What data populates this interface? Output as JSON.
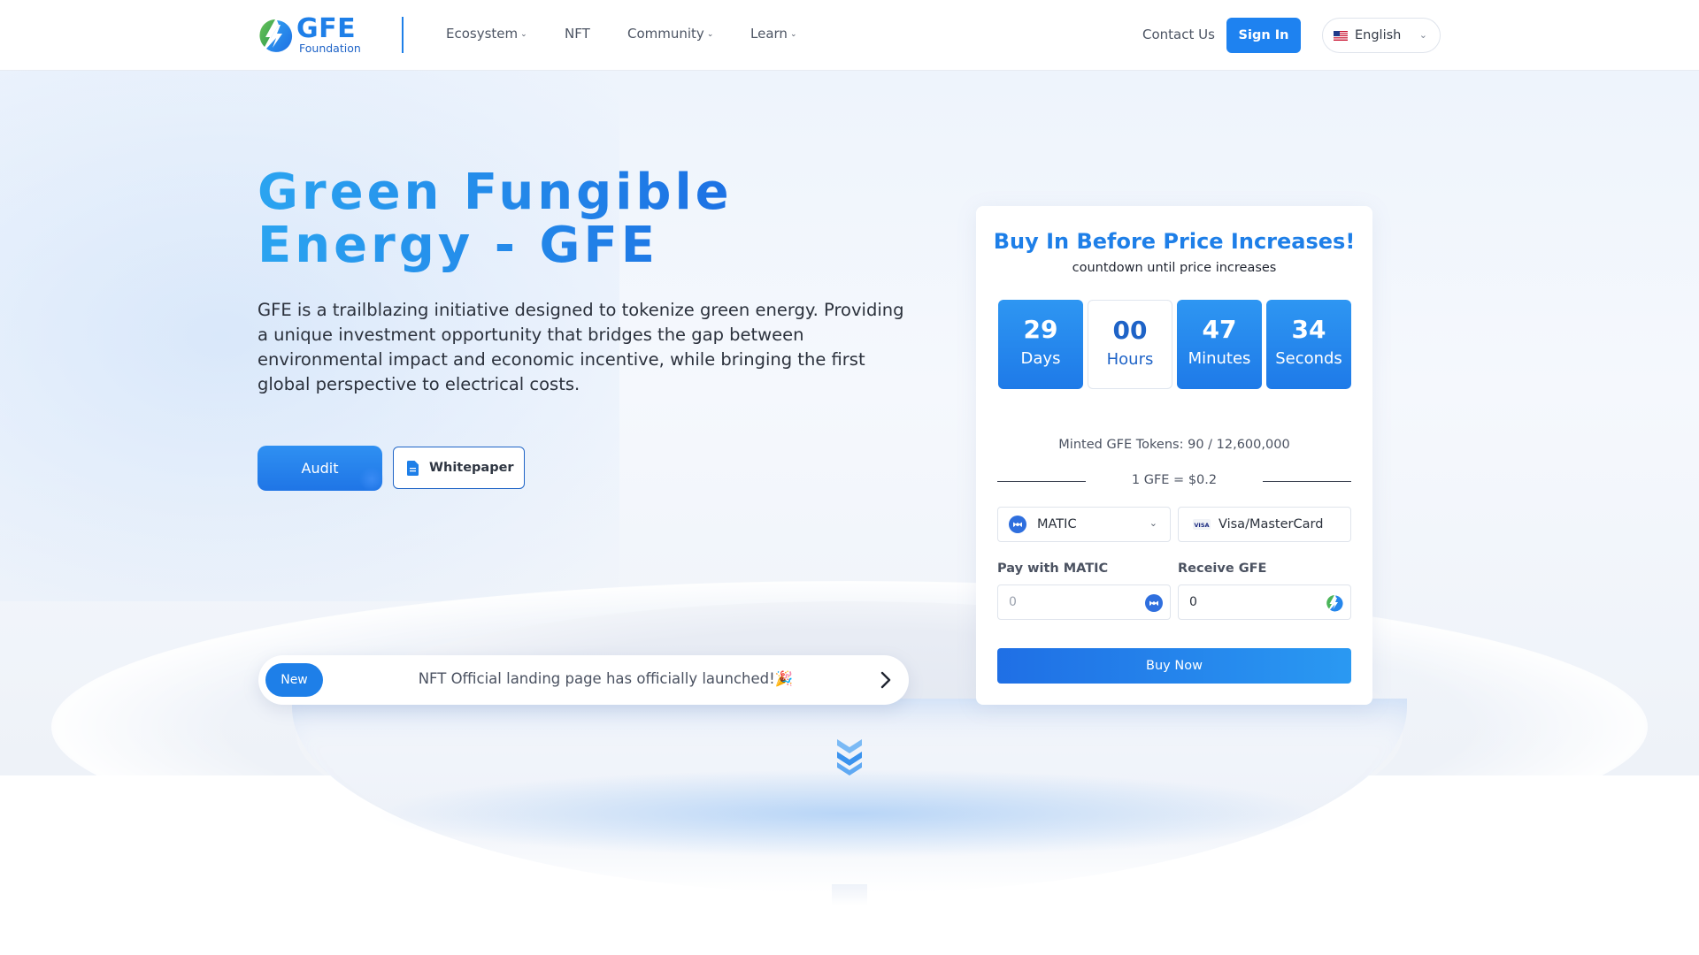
{
  "brand": {
    "name": "GFE",
    "tagline": "Foundation"
  },
  "nav": {
    "items": [
      {
        "label": "Ecosystem",
        "has_dropdown": true
      },
      {
        "label": "NFT",
        "has_dropdown": false
      },
      {
        "label": "Community",
        "has_dropdown": true
      },
      {
        "label": "Learn",
        "has_dropdown": true
      }
    ],
    "contact_label": "Contact Us",
    "signin_label": "Sign In",
    "language": "English"
  },
  "hero": {
    "title": "Green Fungible Energy - GFE",
    "description": "GFE is a trailblazing initiative designed to tokenize green energy. Providing a unique investment opportunity that bridges the gap between environmental impact and economic incentive, while bringing the first global perspective to electrical costs.",
    "audit_label": "Audit",
    "whitepaper_label": "Whitepaper"
  },
  "announcement": {
    "badge": "New",
    "text": "NFT Official landing page has officially launched!🎉"
  },
  "buy_card": {
    "title": "Buy In Before Price Increases!",
    "subtitle": "countdown until price increases",
    "countdown": [
      {
        "value": "29",
        "label": "Days"
      },
      {
        "value": "00",
        "label": "Hours"
      },
      {
        "value": "47",
        "label": "Minutes"
      },
      {
        "value": "34",
        "label": "Seconds"
      }
    ],
    "minted": "Minted GFE Tokens: 90 / 12,600,000",
    "rate": "1 GFE = $0.2",
    "currency_selected": "MATIC",
    "card_option": "Visa/MasterCard",
    "pay_label": "Pay with MATIC",
    "receive_label": "Receive GFE",
    "pay_placeholder": "0",
    "receive_value": "0",
    "buy_label": "Buy Now"
  },
  "colors": {
    "accent": "#1e7fe8",
    "accent_light": "#2ba4f0",
    "text_dark": "#1f2430",
    "text_muted": "#4b5261"
  },
  "icons": {
    "logo": "gfe-bolt-logo",
    "flag": "us-flag-icon",
    "doc": "document-icon",
    "matic": "matic-icon",
    "visa": "visa-icon",
    "arrow": "chevron-right-icon",
    "scroll": "double-chevron-down-icon"
  }
}
